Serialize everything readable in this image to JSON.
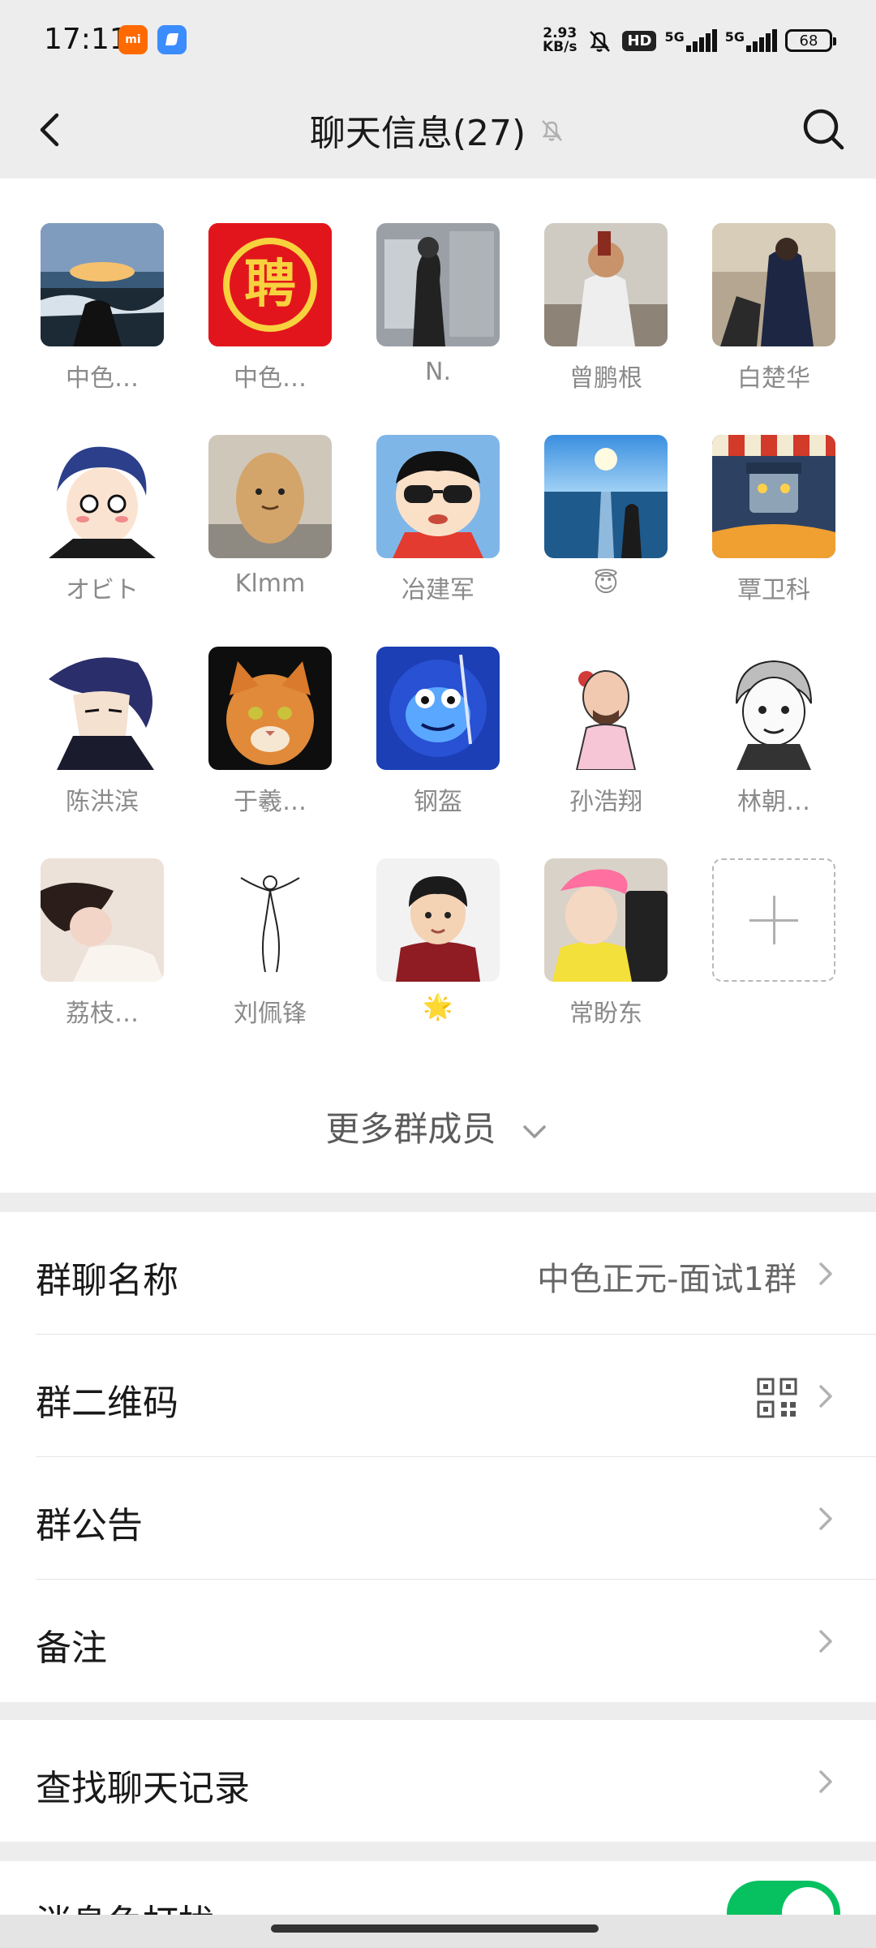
{
  "status_bar": {
    "time": "17:11",
    "speed_value": "2.93",
    "speed_unit": "KB/s",
    "hd": "HD",
    "net1": "5G",
    "net2": "5G",
    "battery": "68"
  },
  "header": {
    "title": "聊天信息(27)",
    "icons": [
      "back-icon",
      "mute-bell-icon",
      "search-icon"
    ]
  },
  "members": [
    {
      "name": "中色…",
      "avatar": "landscape-photo"
    },
    {
      "name": "中色…",
      "avatar": "red-hiring-logo",
      "avatar_text": "聘"
    },
    {
      "name": "N.",
      "avatar": "train-window-photo"
    },
    {
      "name": "曾鹏根",
      "avatar": "person-photo"
    },
    {
      "name": "白楚华",
      "avatar": "street-photo"
    },
    {
      "name": "オビト",
      "avatar": "anime-boy"
    },
    {
      "name": "Klmm",
      "avatar": "potato-toy"
    },
    {
      "name": "冶建军",
      "avatar": "cartoon-boy-sunglasses"
    },
    {
      "name": "😇",
      "avatar": "sea-photo"
    },
    {
      "name": "覃卫科",
      "avatar": "robot-cartoon"
    },
    {
      "name": "陈洪滨",
      "avatar": "anime-man"
    },
    {
      "name": "于羲…",
      "avatar": "orange-cat"
    },
    {
      "name": "钢盔",
      "avatar": "blue-frog"
    },
    {
      "name": "孙浩翔",
      "avatar": "sketch-character"
    },
    {
      "name": "林朝…",
      "avatar": "manga-boy"
    },
    {
      "name": "荔枝…",
      "avatar": "sleeping-girl"
    },
    {
      "name": "刘佩锋",
      "avatar": "ink-figure"
    },
    {
      "name": "🌟",
      "avatar": "cartoon-boy-red"
    },
    {
      "name": "常盼东",
      "avatar": "person-yellow-shirt"
    }
  ],
  "more_members": "更多群成员",
  "settings": {
    "group_name_label": "群聊名称",
    "group_name_value": "中色正元-面试1群",
    "qr_label": "群二维码",
    "notice_label": "群公告",
    "remark_label": "备注",
    "search_history_label": "查找聊天记录",
    "dnd_label": "消息免打扰",
    "dnd_on": true
  },
  "colors": {
    "accent": "#07c160",
    "background": "#ededed"
  }
}
